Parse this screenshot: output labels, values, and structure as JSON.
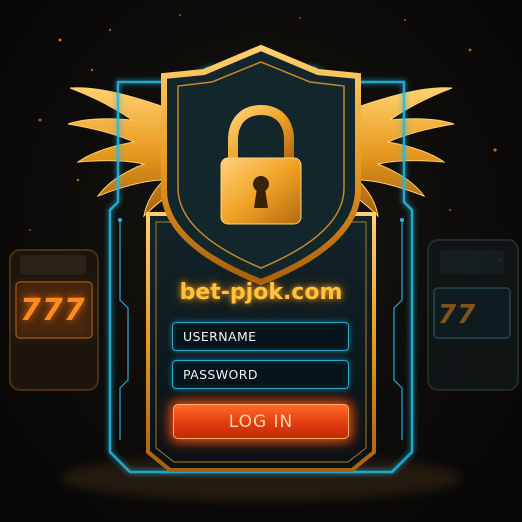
{
  "site": {
    "name": "bet-pjok.com"
  },
  "login_form": {
    "username_placeholder": "USERNAME",
    "password_placeholder": "PASSWORD",
    "login_label": "LOG IN"
  },
  "decor": {
    "slot_left_reels": "777",
    "slot_right_reels": "77"
  },
  "icons": {
    "lock": "padlock-icon",
    "wings": "wings-icon",
    "shield": "shield-icon"
  },
  "colors": {
    "gold": "#f0a325",
    "cyan_glow": "#26b8e0",
    "button_red": "#e43c10",
    "background": "#0d0c0a"
  }
}
